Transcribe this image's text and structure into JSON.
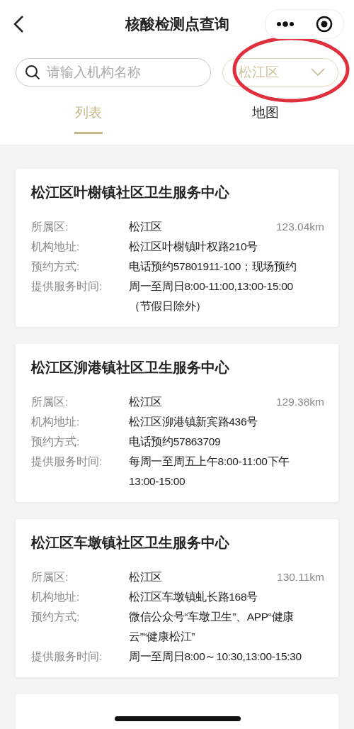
{
  "header": {
    "title": "核酸检测点查询"
  },
  "search": {
    "placeholder": "请输入机构名称"
  },
  "district_select": {
    "value": "松江区"
  },
  "tabs": [
    {
      "label": "列表",
      "selected": true
    },
    {
      "label": "地图",
      "selected": false
    }
  ],
  "cards": [
    {
      "title": "松江区叶榭镇社区卫生服务中心",
      "distance": "123.04km",
      "fields": [
        {
          "label": "所属区:",
          "lines": [
            "松江区"
          ]
        },
        {
          "label": "机构地址:",
          "lines": [
            "松江区叶榭镇叶权路210号"
          ]
        },
        {
          "label": "预约方式:",
          "lines": [
            "电话预约57801911-100；现场预约"
          ]
        },
        {
          "label": "提供服务时间:",
          "lines": [
            "周一至周日8:00-11:00,13:00-15:00",
            "（节假日除外）"
          ]
        }
      ]
    },
    {
      "title": "松江区泖港镇社区卫生服务中心",
      "distance": "129.38km",
      "fields": [
        {
          "label": "所属区:",
          "lines": [
            "松江区"
          ]
        },
        {
          "label": "机构地址:",
          "lines": [
            "松江区泖港镇新宾路436号"
          ]
        },
        {
          "label": "预约方式:",
          "lines": [
            "电话预约57863709"
          ]
        },
        {
          "label": "提供服务时间:",
          "lines": [
            "每周一至周五上午8:00-11:00下午",
            "13:00-15:00"
          ]
        }
      ]
    },
    {
      "title": "松江区车墩镇社区卫生服务中心",
      "distance": "130.11km",
      "fields": [
        {
          "label": "所属区:",
          "lines": [
            "松江区"
          ]
        },
        {
          "label": "机构地址:",
          "lines": [
            "松江区车墩镇虬长路168号"
          ]
        },
        {
          "label": "预约方式:",
          "lines": [
            "微信公众号“车墩卫生”、APP“健康",
            "云”“健康松江”"
          ]
        },
        {
          "label": "提供服务时间:",
          "lines": [
            "周一至周日8:00～10:30,13:00-15:30"
          ]
        }
      ]
    }
  ]
}
